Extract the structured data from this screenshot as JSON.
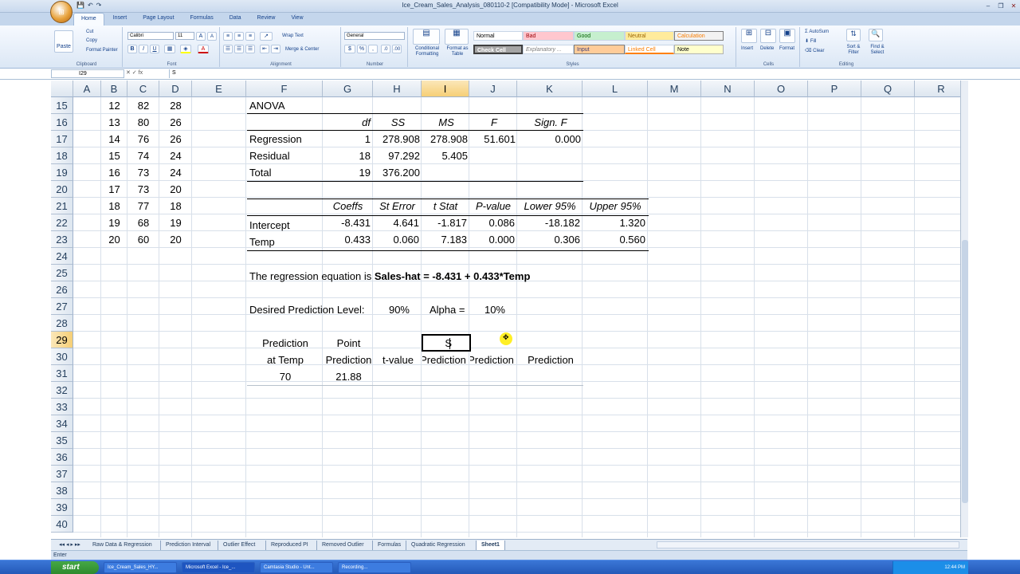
{
  "window": {
    "title": "Ice_Cream_Sales_Analysis_080110-2  [Compatibility Mode] - Microsoft Excel",
    "controls": {
      "minimize": "–",
      "restore": "❐",
      "close": "✕"
    }
  },
  "ribbon": {
    "tabs": [
      "Home",
      "Insert",
      "Page Layout",
      "Formulas",
      "Data",
      "Review",
      "View"
    ],
    "active_tab": "Home",
    "clipboard": {
      "paste": "Paste",
      "cut": "Cut",
      "copy": "Copy",
      "format_painter": "Format Painter",
      "label": "Clipboard"
    },
    "font": {
      "name": "Calibri",
      "size": "11",
      "label": "Font",
      "bold": "B",
      "italic": "I",
      "underline": "U",
      "grow": "A",
      "shrink": "A",
      "color": "A"
    },
    "alignment": {
      "wrap": "Wrap Text",
      "merge": "Merge & Center",
      "label": "Alignment"
    },
    "number": {
      "format": "General",
      "currency": "$",
      "percent": "%",
      "comma": ",",
      "label": "Number"
    },
    "styles": {
      "conditional": "Conditional Formatting",
      "format_table": "Format as Table",
      "cells": [
        "Normal",
        "Bad",
        "Good",
        "Neutral",
        "Calculation",
        "Check Cell",
        "Explanatory ...",
        "Input",
        "Linked Cell",
        "Note"
      ],
      "label": "Styles"
    },
    "cells": {
      "insert": "Insert",
      "delete": "Delete",
      "format": "Format",
      "label": "Cells"
    },
    "editing": {
      "autosum": "AutoSum",
      "fill": "Fill",
      "clear": "Clear",
      "sort": "Sort & Filter",
      "find": "Find & Select",
      "label": "Editing"
    }
  },
  "formula_bar": {
    "name_box": "I29",
    "fx": "fx",
    "content": "S"
  },
  "columns": [
    "A",
    "B",
    "C",
    "D",
    "E",
    "F",
    "G",
    "H",
    "I",
    "J",
    "K",
    "L",
    "M",
    "N",
    "O",
    "P",
    "Q",
    "R"
  ],
  "selected_column": "I",
  "rows": [
    "15",
    "16",
    "17",
    "18",
    "19",
    "20",
    "21",
    "22",
    "23",
    "24",
    "25",
    "26",
    "27",
    "28",
    "29",
    "30",
    "31",
    "32",
    "33",
    "34",
    "35",
    "36",
    "37",
    "38",
    "39",
    "40"
  ],
  "selected_row": "29",
  "data_table": [
    [
      "12",
      "82",
      "28"
    ],
    [
      "13",
      "80",
      "26"
    ],
    [
      "14",
      "76",
      "26"
    ],
    [
      "15",
      "74",
      "24"
    ],
    [
      "16",
      "73",
      "24"
    ],
    [
      "17",
      "73",
      "20"
    ],
    [
      "18",
      "77",
      "18"
    ],
    [
      "19",
      "68",
      "19"
    ],
    [
      "20",
      "60",
      "20"
    ]
  ],
  "anova": {
    "title": "ANOVA",
    "headers": [
      "df",
      "SS",
      "MS",
      "F",
      "Sign. F"
    ],
    "rows": [
      {
        "label": "Regression",
        "df": "1",
        "ss": "278.908",
        "ms": "278.908",
        "f": "51.601",
        "sig": "0.000"
      },
      {
        "label": "Residual",
        "df": "18",
        "ss": "97.292",
        "ms": "5.405"
      },
      {
        "label": "Total",
        "df": "19",
        "ss": "376.200"
      }
    ]
  },
  "coeffs": {
    "headers": [
      "Coeffs",
      "St Error",
      "t Stat",
      "P-value",
      "Lower 95%",
      "Upper 95%"
    ],
    "rows": [
      {
        "label": "Intercept",
        "values": [
          "-8.431",
          "4.641",
          "-1.817",
          "0.086",
          "-18.182",
          "1.320"
        ]
      },
      {
        "label": "Temp",
        "values": [
          "0.433",
          "0.060",
          "7.183",
          "0.000",
          "0.306",
          "0.560"
        ]
      }
    ]
  },
  "equation": {
    "prefix": "The regression equation is ",
    "formula": "Sales-hat = -8.431 + 0.433*Temp"
  },
  "prediction_level": {
    "label": "Desired Prediction Level:",
    "value": "90%",
    "alpha_label": "Alpha =",
    "alpha_value": "10%"
  },
  "prediction_table": {
    "row29": {
      "f": "Prediction",
      "g": "Point",
      "i": "S"
    },
    "row30": {
      "f": "at Temp",
      "g": "Prediction",
      "h": "t-value",
      "i": "Prediction",
      "j": "Prediction",
      "k": "Prediction"
    },
    "row31": {
      "f": "70",
      "g": "21.88"
    }
  },
  "sheet_tabs": [
    "Raw Data & Regression",
    "Prediction Interval",
    "Outlier Effect",
    "Reproduced PI",
    "Removed Outlier",
    "Formulas",
    "Quadratic Regression",
    "Sheet1"
  ],
  "active_sheet": "Sheet1",
  "status": "Enter",
  "taskbar": {
    "start": "start",
    "tasks": [
      "Ice_Cream_Sales_HY...",
      "Microsoft Excel - Ice_...",
      "Camtasia Studio - Unt...",
      "Recording..."
    ],
    "clock": "12:44 PM"
  }
}
